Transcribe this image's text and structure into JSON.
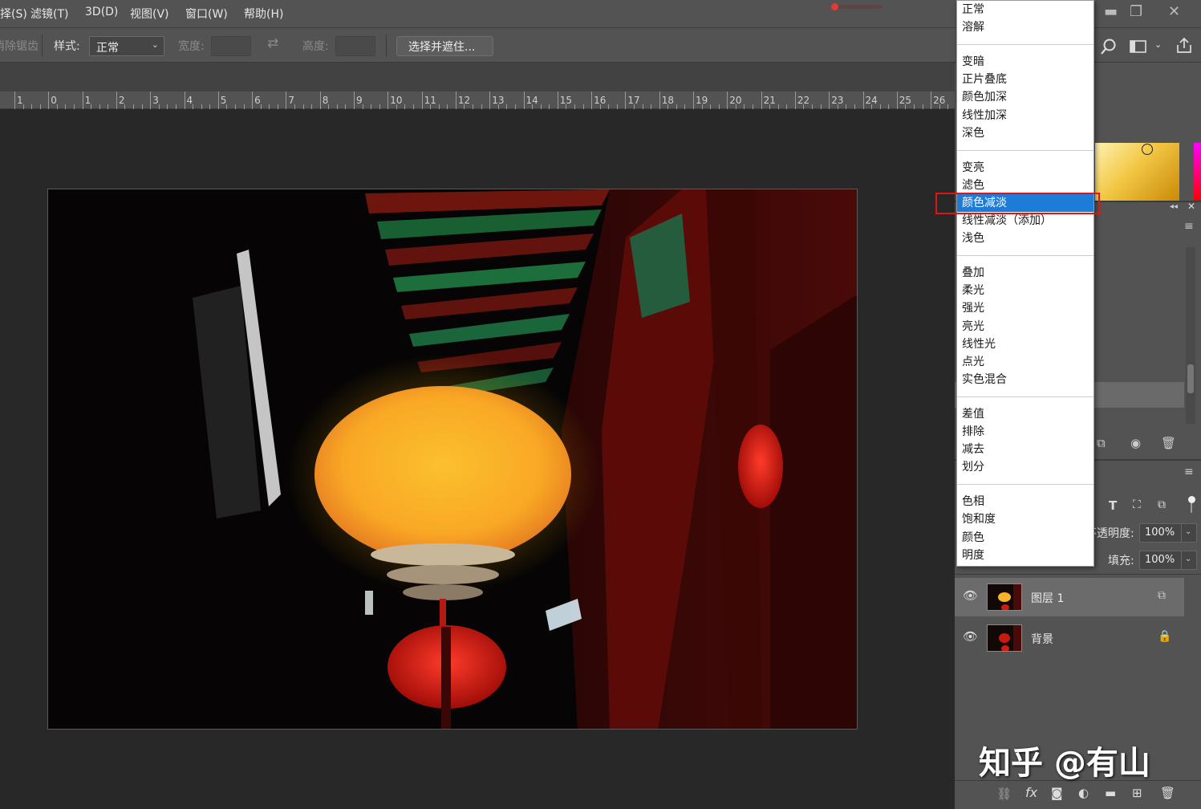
{
  "menubar": {
    "items": [
      "择(S)",
      "滤镜(T)",
      "3D(D)",
      "视图(V)",
      "窗口(W)",
      "帮助(H)"
    ]
  },
  "options": {
    "antialias_label": "消除锯齿",
    "style_label": "样式:",
    "style_value": "正常",
    "width_label": "宽度:",
    "height_label": "高度:",
    "select_mask_button": "选择并遮住..."
  },
  "ruler": {
    "labels": [
      "1",
      "0",
      "1",
      "2",
      "3",
      "4",
      "5",
      "6",
      "7",
      "8",
      "9",
      "10",
      "11",
      "12",
      "13",
      "14",
      "15",
      "16",
      "17",
      "18",
      "19",
      "20",
      "21",
      "22",
      "23",
      "24",
      "25",
      "26"
    ]
  },
  "blend_modes": {
    "groups": [
      [
        "正常",
        "溶解"
      ],
      [
        "变暗",
        "正片叠底",
        "颜色加深",
        "线性加深",
        "深色"
      ],
      [
        "变亮",
        "滤色",
        "颜色减淡",
        "线性减淡（添加）",
        "浅色"
      ],
      [
        "叠加",
        "柔光",
        "强光",
        "亮光",
        "线性光",
        "点光",
        "实色混合"
      ],
      [
        "差值",
        "排除",
        "减去",
        "划分"
      ],
      [
        "色相",
        "饱和度",
        "颜色",
        "明度"
      ]
    ],
    "selected": "颜色减淡"
  },
  "layers_panel": {
    "opacity_label": "不透明度:",
    "opacity_value": "100%",
    "fill_label": "填充:",
    "fill_value": "100%",
    "layers": [
      {
        "name": "图层 1",
        "selected": true
      },
      {
        "name": "背景",
        "selected": false
      }
    ]
  },
  "watermark": "知乎 @有山",
  "colors": {
    "accent": "#1e7bd8",
    "highlight": "#e01414",
    "panel_bg": "#535353",
    "canvas_bg": "#282828"
  }
}
